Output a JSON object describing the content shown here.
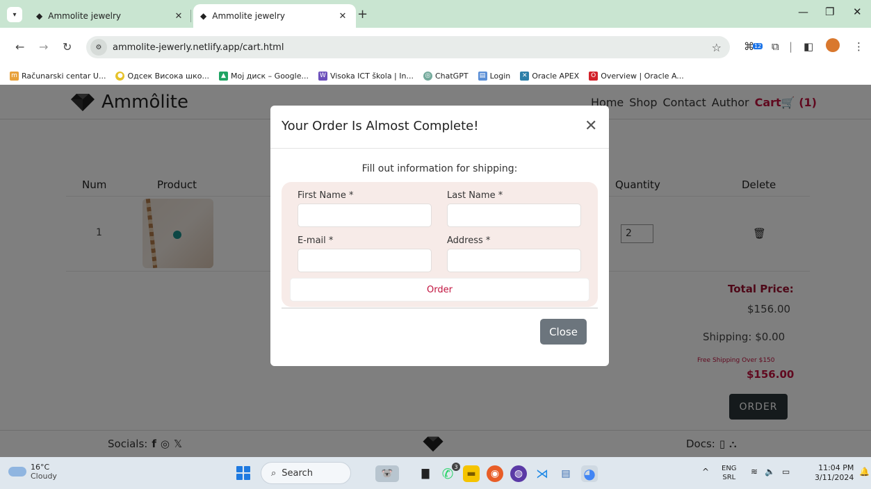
{
  "browser": {
    "tabs": [
      {
        "title": "Ammolite jewelry",
        "active": false
      },
      {
        "title": "Ammolite jewelry",
        "active": true
      }
    ],
    "url": "ammolite-jewerly.netlify.app/cart.html",
    "extension_badge": "12",
    "bookmarks": [
      {
        "label": "Računarski centar U...",
        "color": "#e8a13a"
      },
      {
        "label": "Одсек Висока шко...",
        "color": "#e6c229"
      },
      {
        "label": "Мој диск – Google...",
        "color": "#1fa463"
      },
      {
        "label": "Visoka ICT škola | In...",
        "color": "#6b4fbb"
      },
      {
        "label": "ChatGPT",
        "color": "#74aa9c"
      },
      {
        "label": "Login",
        "color": "#5b8fd6"
      },
      {
        "label": "Oracle APEX",
        "color": "#2d7fa8"
      },
      {
        "label": "Overview | Oracle A...",
        "color": "#d3222a"
      }
    ]
  },
  "site": {
    "brand": "Ammôlite",
    "menu": [
      "Home",
      "Shop",
      "Contact",
      "Author"
    ],
    "cart_label": "Cart",
    "cart_count": "(1)",
    "accent_color": "#c1123e"
  },
  "cart": {
    "headers": {
      "num": "Num",
      "product": "Product",
      "quantity": "Quantity",
      "delete": "Delete"
    },
    "rows": [
      {
        "num": "1",
        "quantity": "2"
      }
    ],
    "total_label": "Total Price:",
    "total_value": "$156.00",
    "shipping": "Shipping: $0.00",
    "free_shipping_note": "Free Shipping Over $150",
    "final_total": "$156.00",
    "order_button": "ORDER"
  },
  "footer": {
    "socials_label": "Socials:",
    "docs_label": "Docs:"
  },
  "modal": {
    "title": "Your Order Is Almost Complete!",
    "subtitle": "Fill out information for shipping:",
    "fields": {
      "first_name": "First Name *",
      "last_name": "Last Name *",
      "email": "E-mail *",
      "address": "Address *"
    },
    "order_button": "Order",
    "close_button": "Close"
  },
  "taskbar": {
    "temperature": "16°C",
    "condition": "Cloudy",
    "search_label": "Search",
    "lang_top": "ENG",
    "lang_bottom": "SRL",
    "time": "11:04 PM",
    "date": "3/11/2024",
    "whatsapp_badge": "3"
  }
}
